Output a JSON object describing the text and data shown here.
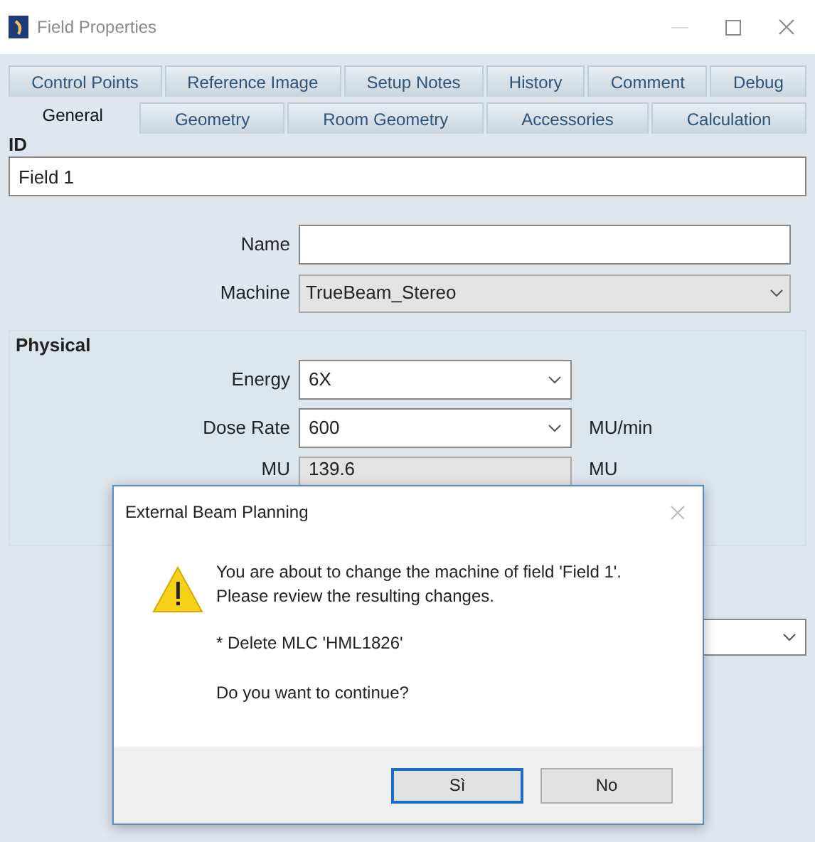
{
  "window": {
    "title": "Field Properties"
  },
  "tab_rows": [
    [
      {
        "label": "Control Points",
        "selected": false
      },
      {
        "label": "Reference Image",
        "selected": false
      },
      {
        "label": "Setup Notes",
        "selected": false
      },
      {
        "label": "History",
        "selected": false
      },
      {
        "label": "Comment",
        "selected": false
      },
      {
        "label": "Debug",
        "selected": false
      }
    ],
    [
      {
        "label": "General",
        "selected": true
      },
      {
        "label": "Geometry",
        "selected": false
      },
      {
        "label": "Room Geometry",
        "selected": false
      },
      {
        "label": "Accessories",
        "selected": false
      },
      {
        "label": "Calculation",
        "selected": false
      }
    ]
  ],
  "id_section": {
    "heading": "ID",
    "value": "Field 1"
  },
  "name_field": {
    "label": "Name"
  },
  "machine_field": {
    "label": "Machine",
    "value": "TrueBeam_Stereo",
    "disabled": true
  },
  "physical": {
    "heading": "Physical",
    "rows": [
      {
        "kind": "dropdown",
        "label": "Energy",
        "value": "6X",
        "disabled": false
      },
      {
        "kind": "dropdown",
        "label": "Dose Rate",
        "value": "600",
        "unit": "MU/min",
        "disabled": false
      },
      {
        "kind": "field",
        "label": "MU",
        "value": "139.6",
        "unit": "MU",
        "disabled": true
      }
    ]
  },
  "dialog": {
    "title": "External Beam Planning",
    "lines": [
      "You are about to change the machine of field 'Field 1'.",
      "Please review the resulting changes."
    ],
    "detail": "* Delete MLC 'HML1826'",
    "question": "Do you want to continue?",
    "buttons": [
      {
        "label": "Sì",
        "selected": true
      },
      {
        "label": "No",
        "selected": false
      }
    ]
  }
}
